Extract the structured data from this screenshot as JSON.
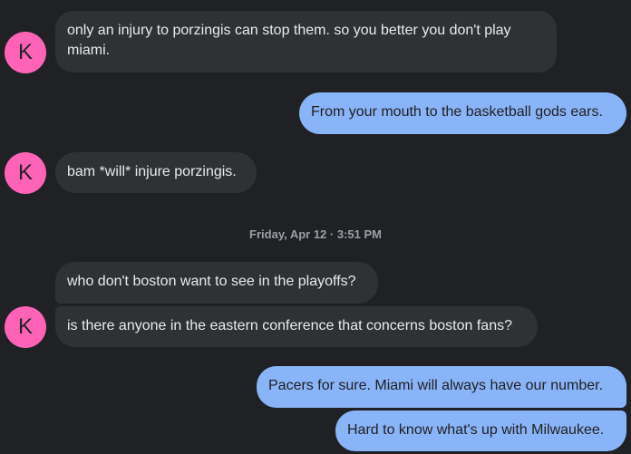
{
  "contact": {
    "avatar_letter": "K",
    "avatar_color": "#ff63b8"
  },
  "colors": {
    "background": "#202124",
    "incoming_bubble": "#303134",
    "outgoing_bubble": "#8ab4f8"
  },
  "messages": [
    {
      "direction": "incoming",
      "line1": "only an injury to porzingis can stop them. so you better you don't play",
      "line2": "miami."
    },
    {
      "direction": "outgoing",
      "text": "From your mouth to the basketball gods ears."
    },
    {
      "direction": "incoming",
      "text": "bam *will* injure porzingis."
    },
    {
      "direction": "incoming",
      "text": "who don't boston want to see in the playoffs?"
    },
    {
      "direction": "incoming",
      "text": "is there anyone in the eastern conference that concerns boston fans?"
    },
    {
      "direction": "outgoing",
      "text": "Pacers for sure. Miami will always have our number."
    },
    {
      "direction": "outgoing",
      "text": "Hard to know what's up with Milwaukee."
    }
  ],
  "timestamp": "Friday, Apr 12 · 3:51 PM"
}
